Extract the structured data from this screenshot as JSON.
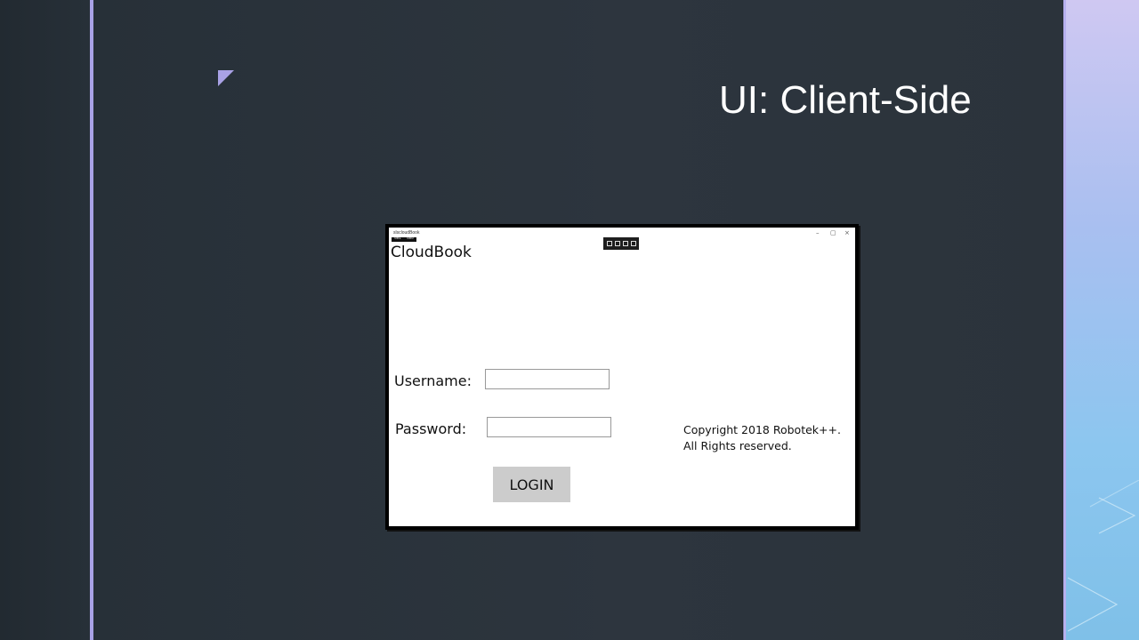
{
  "slide": {
    "title": "UI: Client-Side"
  },
  "colors": {
    "slide_background": "#2b333c",
    "accent": "#a9a2e6",
    "right_panel_top": "#cfc8f2",
    "right_panel_bottom": "#7fc0e8"
  },
  "app_window": {
    "titlebar_text": "slscloudBook",
    "frame_counter": [
      "001",
      "000"
    ],
    "window_controls": [
      "–",
      "▢",
      "×"
    ],
    "debug_toolbar_icons": [
      "select-element-icon",
      "display-adorners-icon",
      "track-focus-icon",
      "layout-inspect-icon"
    ],
    "app_name": "CloudBook",
    "username_label": "Username:",
    "username_value": "",
    "password_label": "Password:",
    "password_value": "",
    "login_label": "LOGIN",
    "copyright_line1": "Copyright 2018 Robotek++.",
    "copyright_line2": "All Rights reserved."
  }
}
